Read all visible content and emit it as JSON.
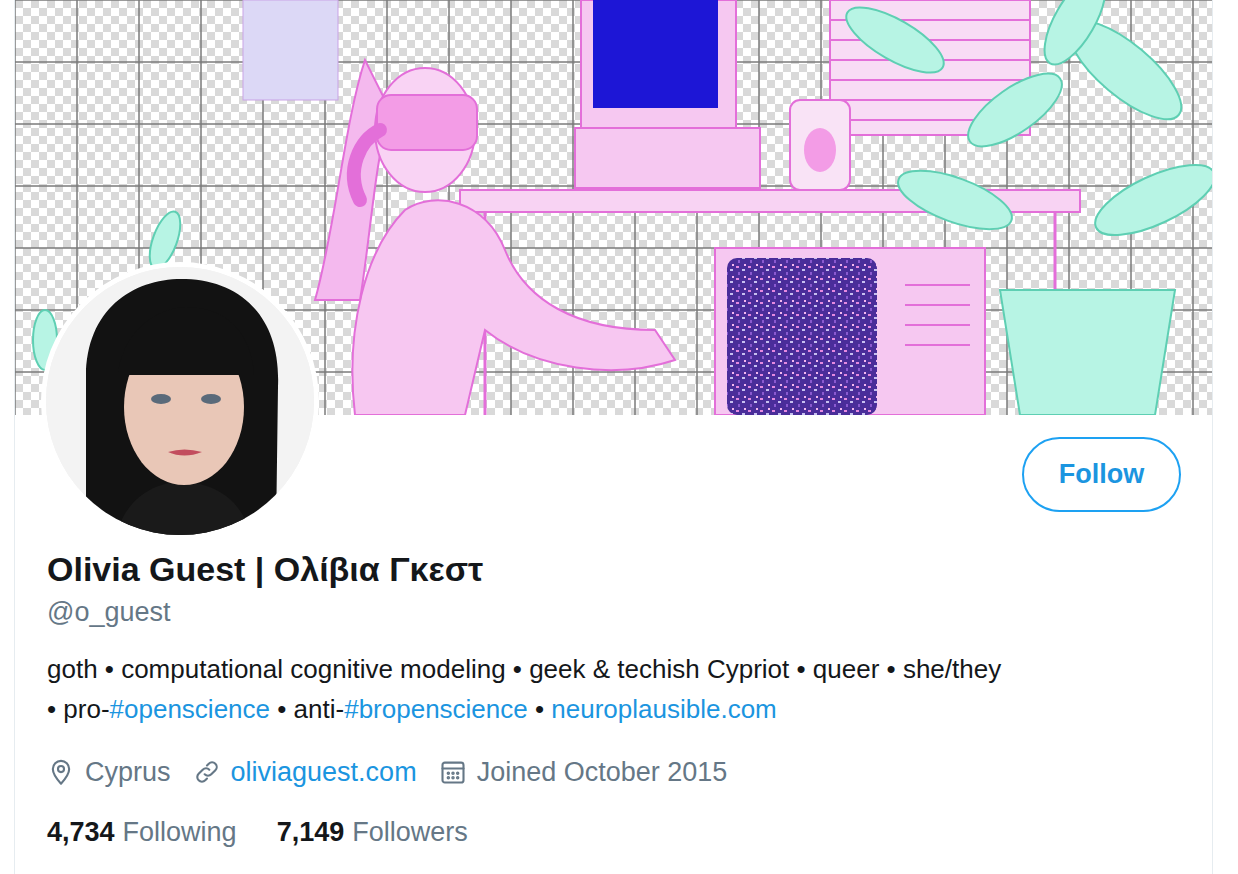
{
  "profile": {
    "name": "Olivia Guest | Ολίβια Γκεστ",
    "handle": "@o_guest",
    "bio": {
      "lines": [
        [
          {
            "text": "goth • computational cognitive modeling • geek & techish Cypriot • queer • she/they",
            "kind": "text"
          }
        ],
        [
          {
            "text": "• pro-",
            "kind": "text"
          },
          {
            "text": "#openscience",
            "kind": "link"
          },
          {
            "text": " • anti-",
            "kind": "text"
          },
          {
            "text": "#bropenscience",
            "kind": "link"
          },
          {
            "text": " • ",
            "kind": "text"
          },
          {
            "text": "neuroplausible.com",
            "kind": "link"
          }
        ]
      ]
    },
    "meta": [
      {
        "text": "Cyprus",
        "kind": "location"
      },
      {
        "text": "oliviaguest.com",
        "kind": "website"
      },
      {
        "text": "Joined October 2015",
        "kind": "joined"
      }
    ],
    "stats": [
      {
        "count": "4,734",
        "label": "Following"
      },
      {
        "count": "7,149",
        "label": "Followers"
      }
    ],
    "follow_button": {
      "label": "Follow"
    }
  }
}
